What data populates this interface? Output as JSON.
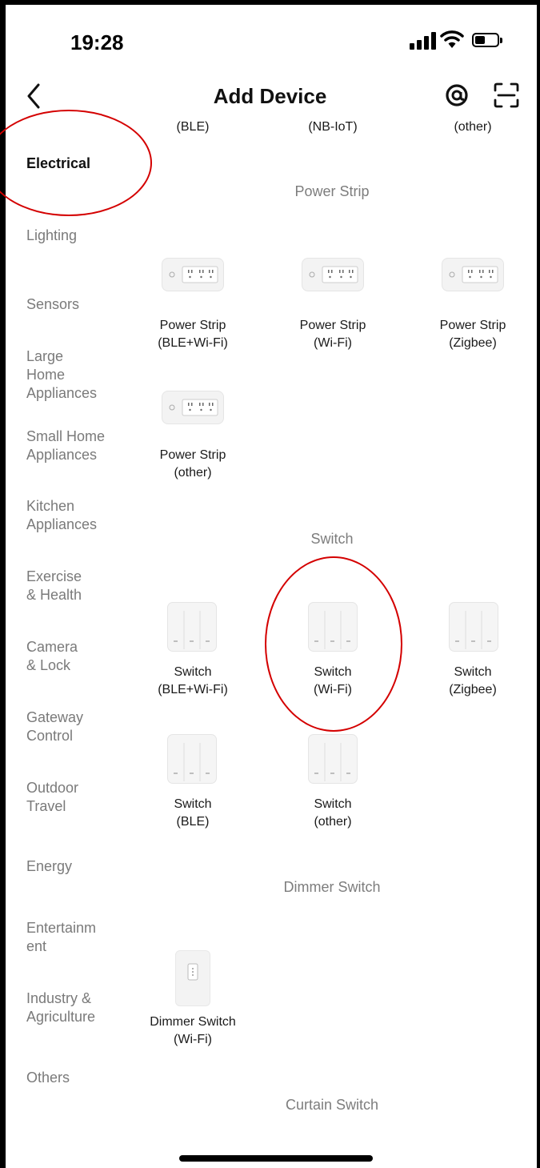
{
  "status": {
    "time": "19:28"
  },
  "nav": {
    "title": "Add Device",
    "back_icon": "chevron-left-icon",
    "at_icon": "at-sign-icon",
    "scan_icon": "scan-icon"
  },
  "sidebar": {
    "items": [
      {
        "label": "Electrical",
        "active": true
      },
      {
        "label": "Lighting"
      },
      {
        "label": "Sensors"
      },
      {
        "label": "Large\nHome\nAppliances"
      },
      {
        "label": "Small Home\nAppliances"
      },
      {
        "label": "Kitchen\nAppliances"
      },
      {
        "label": "Exercise\n& Health"
      },
      {
        "label": "Camera\n& Lock"
      },
      {
        "label": "Gateway\nControl"
      },
      {
        "label": "Outdoor\nTravel"
      },
      {
        "label": "Energy"
      },
      {
        "label": "Entertainm\nent"
      },
      {
        "label": "Industry &\nAgriculture"
      },
      {
        "label": "Others"
      }
    ]
  },
  "content": {
    "top_row": [
      "(BLE)",
      "(NB-IoT)",
      "(other)"
    ],
    "sections": [
      {
        "title": "Power Strip",
        "devices": [
          {
            "name": "Power Strip",
            "variant": "(BLE+Wi-Fi)"
          },
          {
            "name": "Power Strip",
            "variant": "(Wi-Fi)"
          },
          {
            "name": "Power Strip",
            "variant": "(Zigbee)"
          },
          {
            "name": "Power Strip",
            "variant": "(other)"
          }
        ]
      },
      {
        "title": "Switch",
        "devices": [
          {
            "name": "Switch",
            "variant": "(BLE+Wi-Fi)"
          },
          {
            "name": "Switch",
            "variant": "(Wi-Fi)"
          },
          {
            "name": "Switch",
            "variant": "(Zigbee)"
          },
          {
            "name": "Switch",
            "variant": "(BLE)"
          },
          {
            "name": "Switch",
            "variant": "(other)"
          }
        ]
      },
      {
        "title": "Dimmer Switch",
        "devices": [
          {
            "name": "Dimmer Switch",
            "variant": "(Wi-Fi)"
          }
        ]
      },
      {
        "title": "Curtain Switch",
        "devices": []
      }
    ]
  },
  "colors": {
    "annotation": "#d40000",
    "active_text": "#111111",
    "inactive_text": "#7a7a7a"
  }
}
